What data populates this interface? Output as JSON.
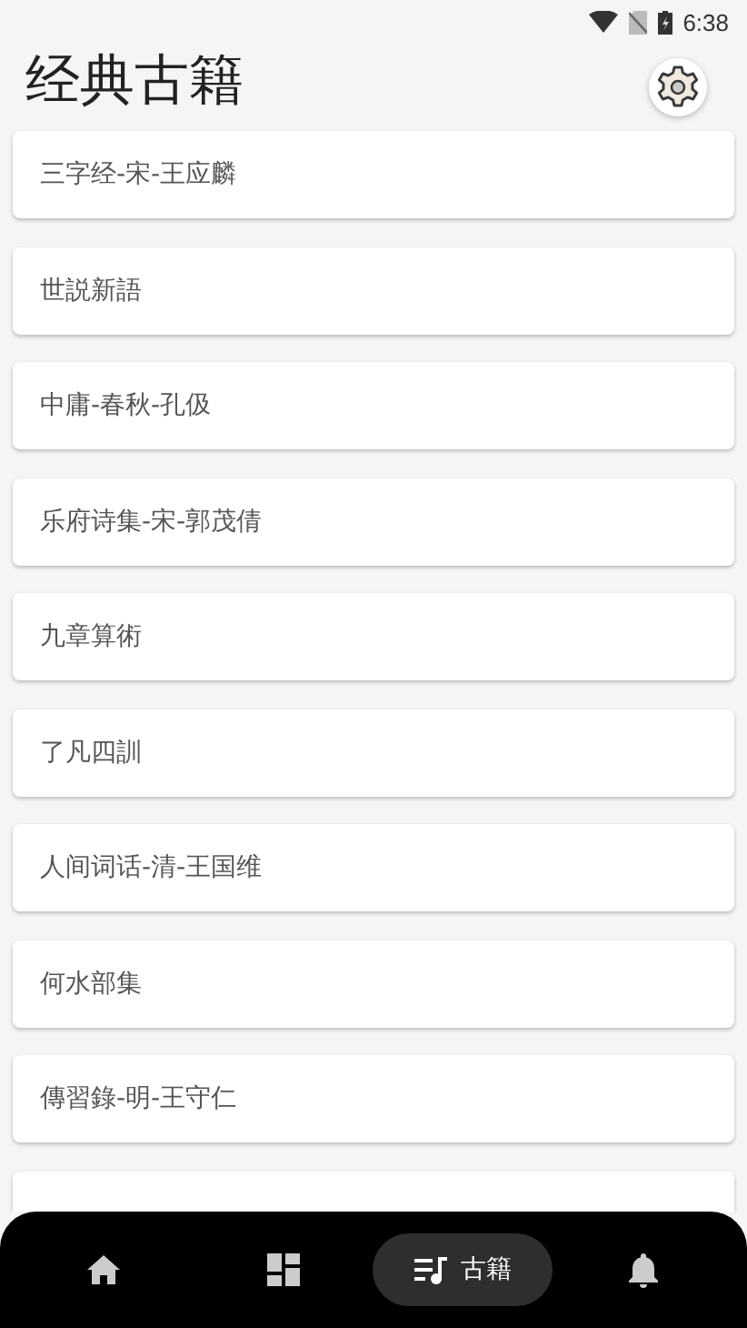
{
  "status_bar": {
    "time": "6:38"
  },
  "header": {
    "title": "经典古籍"
  },
  "books": [
    {
      "kind": "book",
      "title": "三字经-宋-王应麟"
    },
    {
      "kind": "book",
      "title": "世説新語"
    },
    {
      "kind": "book",
      "title": "中庸-春秋-孔伋"
    },
    {
      "kind": "book",
      "title": "乐府诗集-宋-郭茂倩"
    },
    {
      "kind": "book",
      "title": "九章算術"
    },
    {
      "kind": "book",
      "title": "了凡四訓"
    },
    {
      "kind": "book",
      "title": "人间词话-清-王国维"
    },
    {
      "kind": "book",
      "title": "何水部集"
    },
    {
      "kind": "book",
      "title": "傳習錄-明-王守仁"
    },
    {
      "kind": "partial"
    }
  ],
  "bottom_nav": [
    {
      "kind": "home",
      "selected": false
    },
    {
      "kind": "dashboard",
      "selected": false
    },
    {
      "kind": "books",
      "label": "古籍",
      "selected": true
    },
    {
      "kind": "bell",
      "selected": false
    }
  ]
}
